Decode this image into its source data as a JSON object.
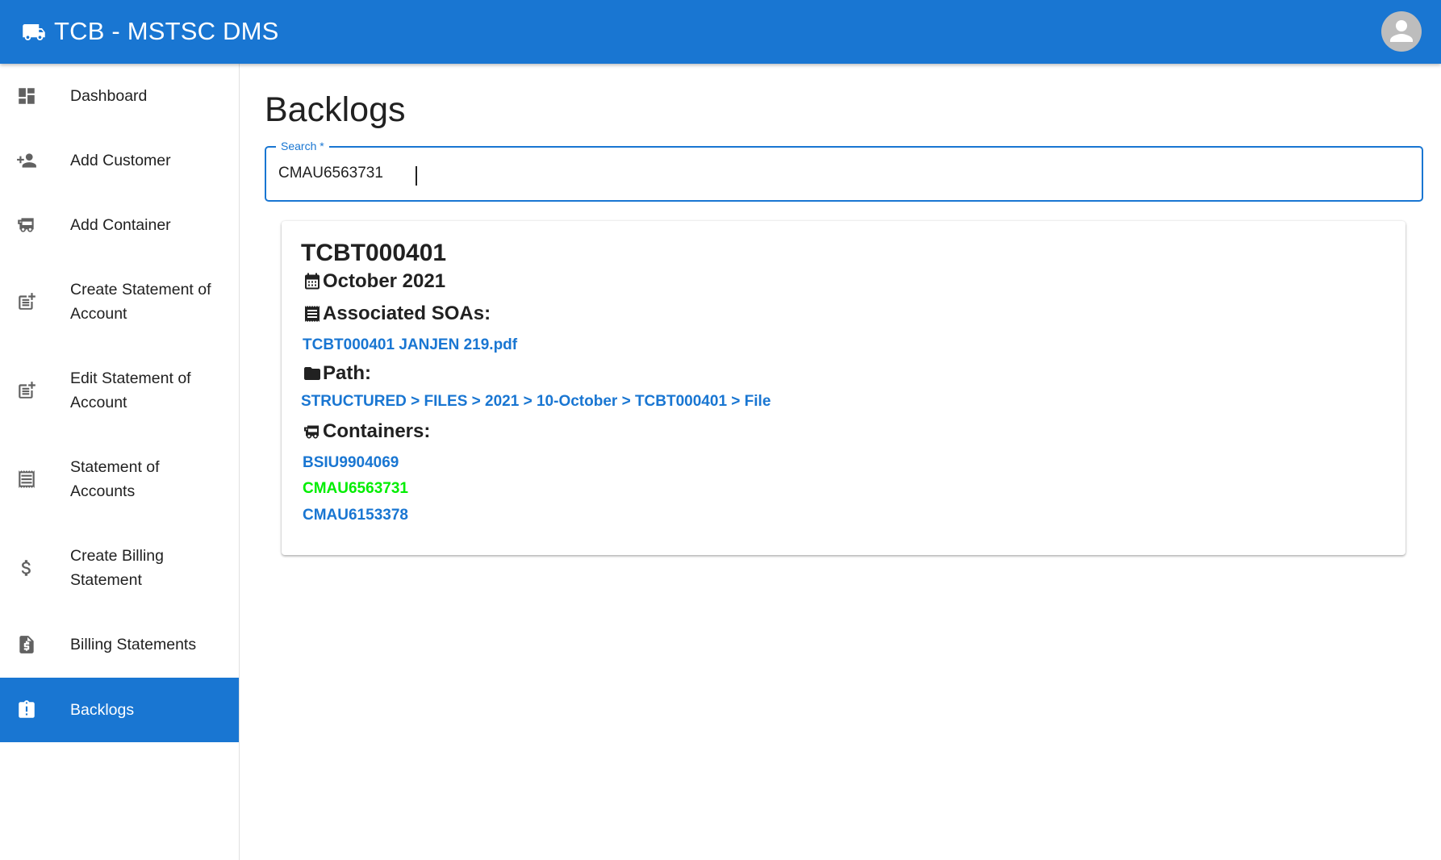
{
  "app": {
    "title": "TCB - MSTSC DMS",
    "brand_color": "#1976d2"
  },
  "sidebar": {
    "items": [
      {
        "label": "Dashboard",
        "icon": "dashboard-icon"
      },
      {
        "label": "Add Customer",
        "icon": "person-add-icon"
      },
      {
        "label": "Add Container",
        "icon": "rv-truck-icon"
      },
      {
        "label": "Create Statement of Account",
        "icon": "post-add-icon"
      },
      {
        "label": "Edit Statement of Account",
        "icon": "post-add-icon"
      },
      {
        "label": "Statement of Accounts",
        "icon": "receipt-icon"
      },
      {
        "label": "Create Billing Statement",
        "icon": "dollar-icon"
      },
      {
        "label": "Billing Statements",
        "icon": "request-quote-icon"
      },
      {
        "label": "Backlogs",
        "icon": "pending-actions-icon",
        "active": true
      }
    ]
  },
  "main": {
    "title": "Backlogs",
    "search": {
      "label": "Search *",
      "value": "CMAU6563731"
    },
    "result": {
      "title": "TCBT000401",
      "date": "October 2021",
      "soas_heading": "Associated SOAs:",
      "soas": [
        "TCBT000401 JANJEN 219.pdf"
      ],
      "path_heading": "Path:",
      "path": [
        "STRUCTURED",
        "FILES",
        "2021",
        "10-October",
        "TCBT000401",
        "File"
      ],
      "path_separator": " > ",
      "containers_heading": "Containers:",
      "containers": [
        {
          "id": "BSIU9904069",
          "match": false
        },
        {
          "id": "CMAU6563731",
          "match": true
        },
        {
          "id": "CMAU6153378",
          "match": false
        }
      ],
      "match_color": "#00ee00"
    }
  }
}
